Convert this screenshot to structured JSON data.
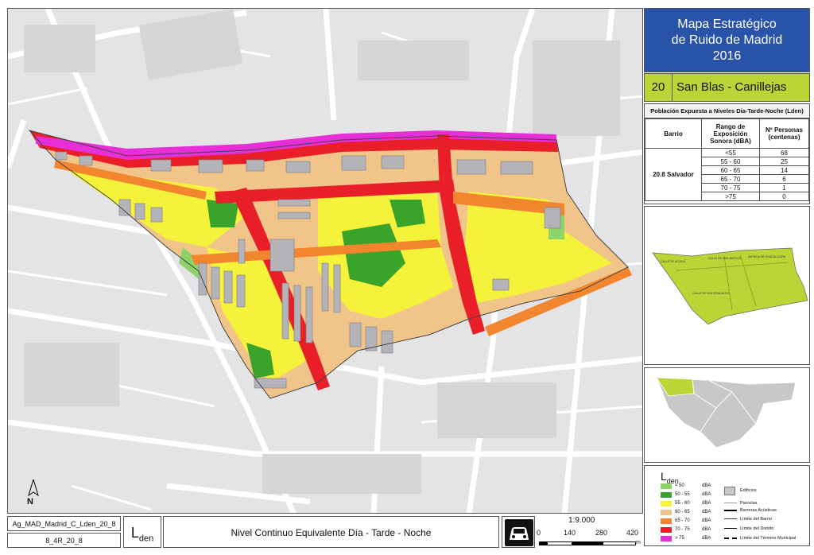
{
  "header": {
    "title_line1": "Mapa Estratégico",
    "title_line2": "de Ruido de Madrid",
    "title_line3": "2016"
  },
  "district": {
    "number": "20",
    "name": "San Blas - Canillejas"
  },
  "population": {
    "title": "Población Expuesta a Niveles Día-Tarde-Noche (Lden)",
    "col_barrio": "Barrio",
    "col_rango": "Rango de Exposición Sonora (dBA)",
    "col_personas": "Nº Personas (centenas)",
    "barrio": "20.8 Salvador",
    "rows": [
      {
        "range": "<55",
        "value": "68"
      },
      {
        "range": "55 - 60",
        "value": "25"
      },
      {
        "range": "60 - 65",
        "value": "14"
      },
      {
        "range": "65 - 70",
        "value": "6"
      },
      {
        "range": "70 - 75",
        "value": "1"
      },
      {
        "range": ">75",
        "value": "0"
      }
    ]
  },
  "legend": {
    "title": "L",
    "title_sub": "den",
    "levels": [
      {
        "label": "< 50",
        "unit": "dBA",
        "color": "#8ed36a"
      },
      {
        "label": "50 - 55",
        "unit": "dBA",
        "color": "#3aa329"
      },
      {
        "label": "55 - 60",
        "unit": "dBA",
        "color": "#f5f23b"
      },
      {
        "label": "60 - 65",
        "unit": "dBA",
        "color": "#f1c58a"
      },
      {
        "label": "65 - 70",
        "unit": "dBA",
        "color": "#f2862f"
      },
      {
        "label": "70 - 75",
        "unit": "dBA",
        "color": "#e81e28"
      },
      {
        "label": "> 75",
        "unit": "dBA",
        "color": "#e62fd6"
      }
    ],
    "symbols": [
      {
        "label": "Edificios"
      },
      {
        "label": "Parcelas"
      },
      {
        "label": "Barreras Acústicas"
      },
      {
        "label": "Límite del Barrio"
      },
      {
        "label": "Límite del Distrito"
      },
      {
        "label": "Límite del Término Municipal"
      }
    ]
  },
  "footer": {
    "code1": "Ag_MAD_Madrid_C_Lden_20_8",
    "code2": "8_4R_20_8",
    "lden": "L",
    "lden_sub": "den",
    "name": "Nivel Continuo Equivalente Día - Tarde - Noche",
    "scale": "1:9.000",
    "ticks": [
      "0",
      "140",
      "280",
      "420"
    ],
    "unit": "m"
  },
  "north": "N",
  "inset_labels": [
    "CALLE DE ALCALÁ",
    "CALLE DE SAN MARCOS",
    "AVENIDA DE GUADALAJARA",
    "CALLE DE SAN ROMUALDO"
  ],
  "colors": {
    "title_bg": "#2853a8",
    "district_bg": "#bcd536",
    "inset_fill": "#bcd536",
    "map_bg": "#e4e4e6"
  }
}
